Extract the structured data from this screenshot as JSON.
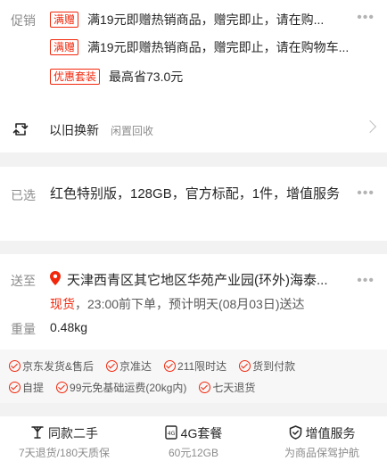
{
  "promo": {
    "label": "促销",
    "rows": [
      {
        "tag": "满赠",
        "text": "满19元即赠热销商品，赠完即止，请在购..."
      },
      {
        "tag": "满赠",
        "text": "满19元即赠热销商品，赠完即止，请在购物车..."
      },
      {
        "tag": "优惠套装",
        "text": "最高省73.0元"
      }
    ]
  },
  "tradein": {
    "icon": "exchange-icon",
    "title": "以旧换新",
    "subtitle": "闲置回收"
  },
  "selected": {
    "label": "已选",
    "value": "红色特别版，128GB，官方标配，1件，增值服务"
  },
  "delivery": {
    "label": "送至",
    "address": "天津西青区其它地区华苑产业园(环外)海泰...",
    "stock_status": "现货",
    "eta": "，23:00前下单，预计明天(08月03日)送达",
    "weight_label": "重量",
    "weight": "0.48kg"
  },
  "services": {
    "row1": [
      "京东发货&售后",
      "京准达",
      "211限时达",
      "货到付款"
    ],
    "row2": [
      "自提",
      "99元免基础运费(20kg内)",
      "七天退货"
    ]
  },
  "features": [
    {
      "icon": "antenna-icon",
      "title": "同款二手",
      "subtitle": "7天退货/180天质保"
    },
    {
      "icon": "sim-4g-icon",
      "title": "4G套餐",
      "subtitle": "60元12GB"
    },
    {
      "icon": "shield-check-icon",
      "title": "增值服务",
      "subtitle": "为商品保驾护航"
    }
  ],
  "colors": {
    "accent": "#f2270c",
    "muted": "#8c8c8c"
  }
}
